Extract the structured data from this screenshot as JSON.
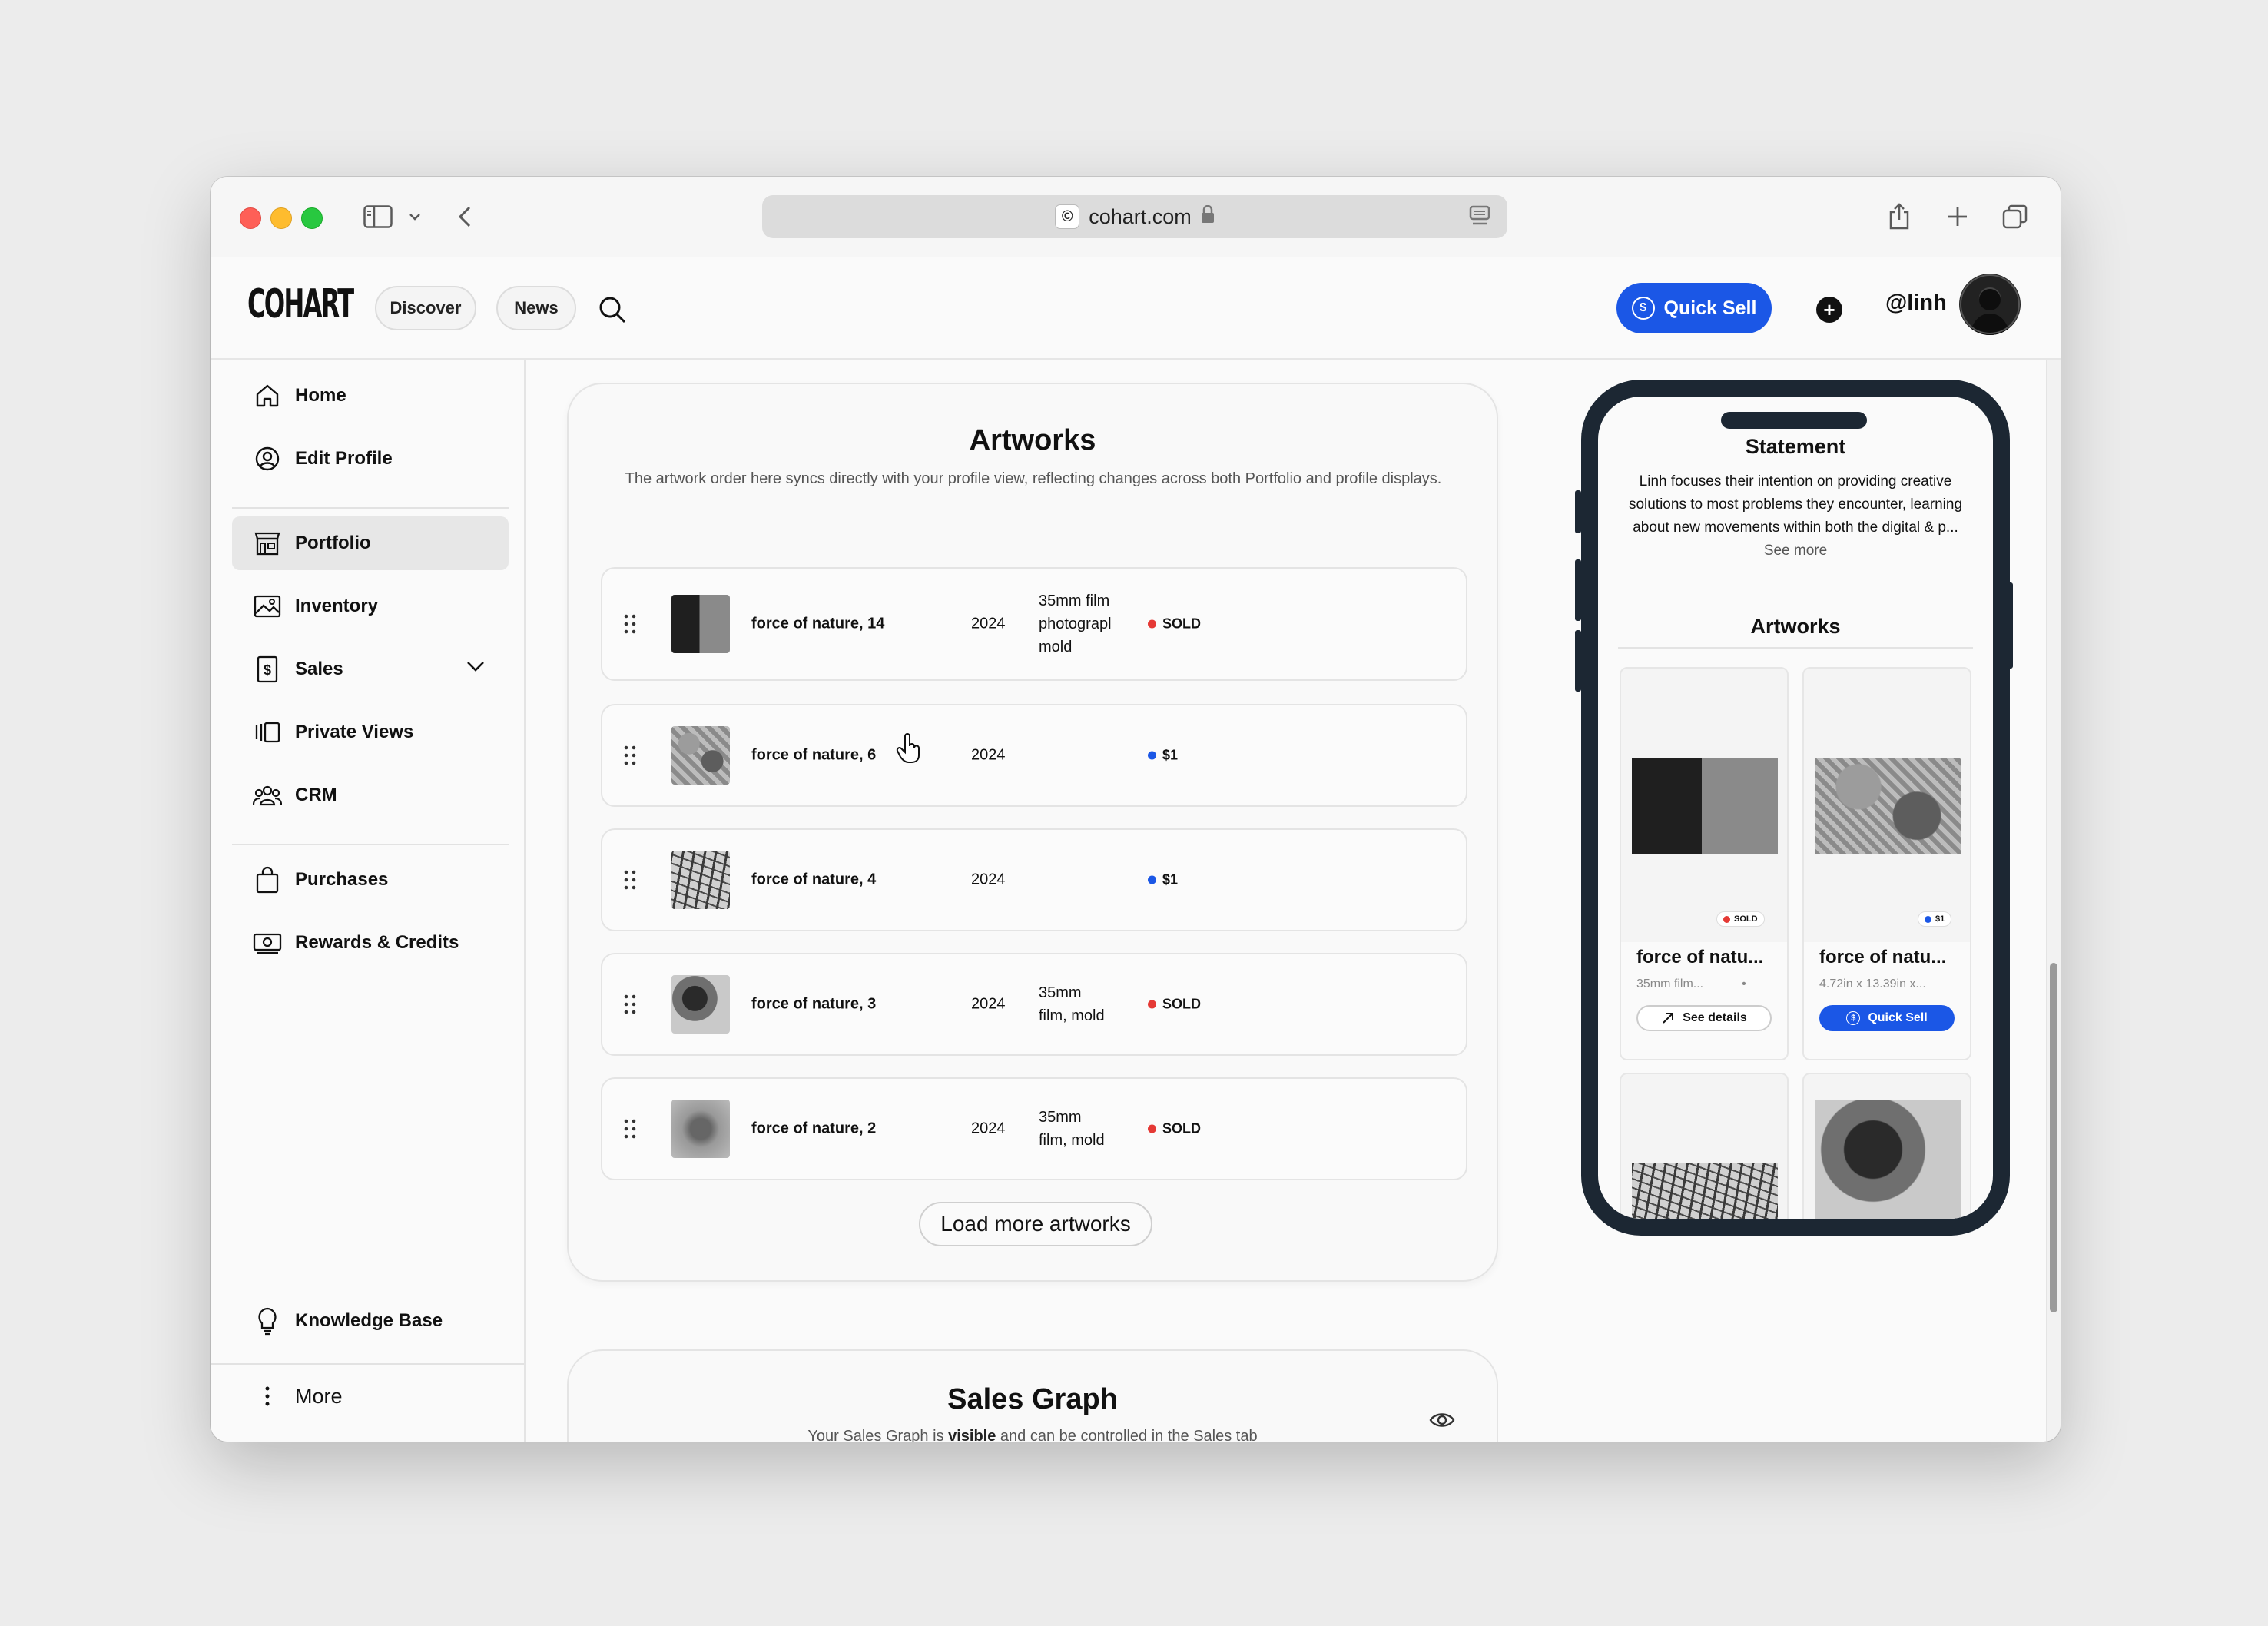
{
  "browser": {
    "url": "cohart.com"
  },
  "header": {
    "logo": "COHART",
    "nav": [
      "Discover",
      "News"
    ],
    "quick_sell": "Quick Sell",
    "handle": "@linh"
  },
  "sidebar": {
    "items": [
      {
        "label": "Home",
        "icon": "home-icon"
      },
      {
        "label": "Edit Profile",
        "icon": "user-circle-icon"
      },
      {
        "label": "Portfolio",
        "icon": "storefront-icon",
        "active": true
      },
      {
        "label": "Inventory",
        "icon": "image-icon"
      },
      {
        "label": "Sales",
        "icon": "dollar-doc-icon"
      },
      {
        "label": "Private Views",
        "icon": "gallery-icon"
      },
      {
        "label": "CRM",
        "icon": "people-icon"
      },
      {
        "label": "Purchases",
        "icon": "bag-icon"
      },
      {
        "label": "Rewards & Credits",
        "icon": "money-icon"
      },
      {
        "label": "Knowledge Base",
        "icon": "lightbulb-icon"
      },
      {
        "label": "More",
        "icon": "more-vertical-icon"
      }
    ]
  },
  "artworks": {
    "title": "Artworks",
    "description": "The artwork order here syncs directly with your profile view, reflecting changes across both Portfolio and profile displays.",
    "rows": [
      {
        "title": "force of nature, 14",
        "year": "2024",
        "medium": [
          "35mm film",
          "photograpl",
          "mold"
        ],
        "status": "SOLD",
        "status_color": "#e53935"
      },
      {
        "title": "force of nature, 6",
        "year": "2024",
        "medium": [],
        "status": "$1",
        "status_color": "#1b57e6"
      },
      {
        "title": "force of nature, 4",
        "year": "2024",
        "medium": [],
        "status": "$1",
        "status_color": "#1b57e6"
      },
      {
        "title": "force of nature, 3",
        "year": "2024",
        "medium": [
          "35mm",
          "film, mold"
        ],
        "status": "SOLD",
        "status_color": "#e53935"
      },
      {
        "title": "force of nature, 2",
        "year": "2024",
        "medium": [
          "35mm",
          "film, mold"
        ],
        "status": "SOLD",
        "status_color": "#e53935"
      }
    ],
    "load_more": "Load more artworks"
  },
  "sales_graph": {
    "title": "Sales Graph",
    "description_pre": "Your Sales Graph is ",
    "description_bold": "visible",
    "description_post": " and can be controlled in the Sales tab"
  },
  "phone": {
    "statement_title": "Statement",
    "statement_text": "Linh focuses their intention on providing creative solutions to most problems they encounter, learning about new movements within both the digital & p...",
    "see_more": "See more",
    "artworks_title": "Artworks",
    "cards": [
      {
        "title": "force of natu...",
        "subtitle": "35mm film...",
        "badge": "SOLD",
        "badge_color": "#e53935",
        "button": "See details"
      },
      {
        "title": "force of natu...",
        "subtitle": "4.72in x 13.39in x...",
        "badge": "$1",
        "badge_color": "#1b57e6",
        "button": "Quick Sell"
      }
    ]
  }
}
